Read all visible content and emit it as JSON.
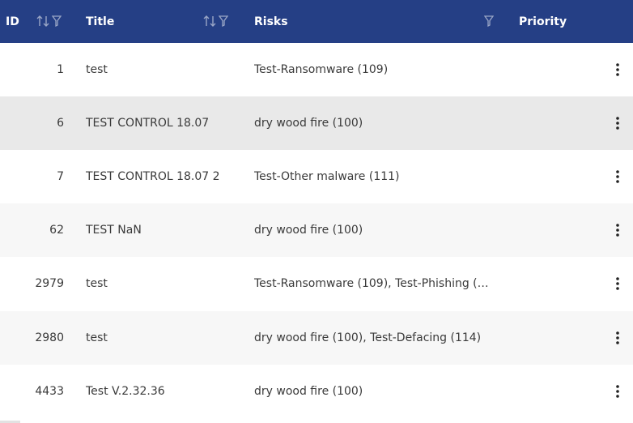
{
  "header": {
    "id_label": "ID",
    "title_label": "Title",
    "risks_label": "Risks",
    "priority_label": "Priority"
  },
  "icons": {
    "sort": "sort-icon",
    "filter": "filter-icon",
    "row_menu": "more-vertical-icon"
  },
  "colors": {
    "header_bg": "#253f85",
    "header_text": "#ffffff",
    "highlight_row": "#e9e9e9",
    "alt_row": "#f7f7f7"
  },
  "rows": [
    {
      "id": "1",
      "title": "test",
      "risks": "Test-Ransomware (109)"
    },
    {
      "id": "6",
      "title": "TEST CONTROL 18.07",
      "risks": "dry wood fire (100)"
    },
    {
      "id": "7",
      "title": "TEST CONTROL 18.07 2",
      "risks": "Test-Other malware (111)"
    },
    {
      "id": "62",
      "title": "TEST NaN",
      "risks": "dry wood fire (100)"
    },
    {
      "id": "2979",
      "title": "test",
      "risks": "Test-Ransomware (109), Test-Phishing (11..."
    },
    {
      "id": "2980",
      "title": "test",
      "risks": "dry wood fire (100), Test-Defacing (114)"
    },
    {
      "id": "4433",
      "title": "Test V.2.32.36",
      "risks": "dry wood fire (100)"
    }
  ]
}
